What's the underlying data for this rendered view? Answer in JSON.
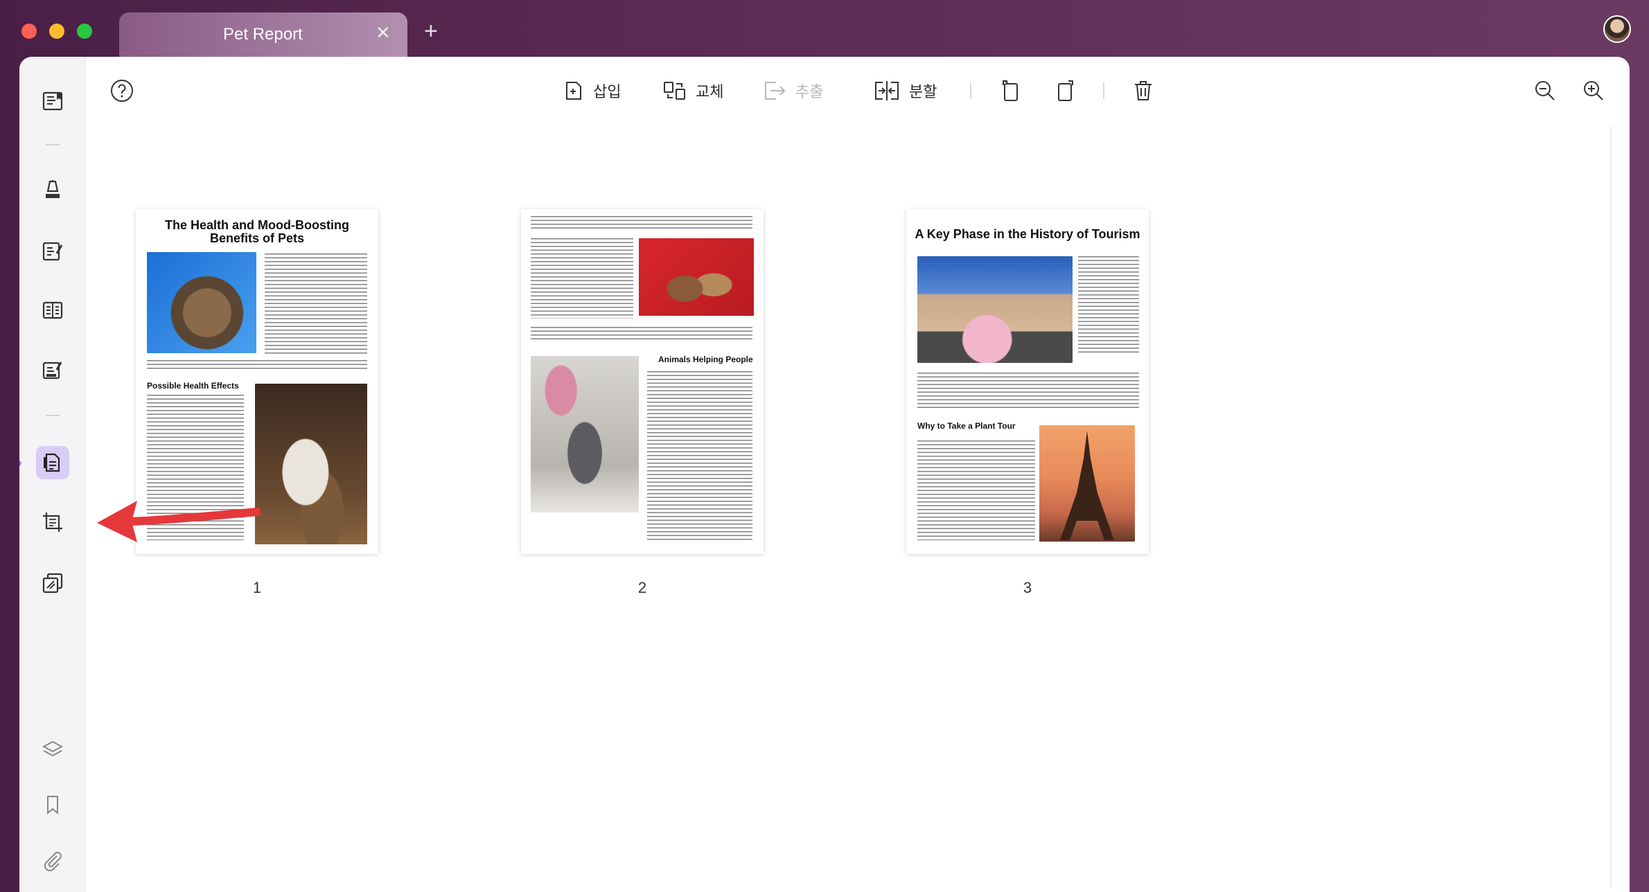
{
  "tab": {
    "title": "Pet Report",
    "close": "✕",
    "add": "+"
  },
  "toolbar": {
    "insert": "삽입",
    "replace": "교체",
    "extract": "추출",
    "split": "분할"
  },
  "pages": [
    {
      "number": "1",
      "title": "The Health and Mood-Boosting Benefits of Pets",
      "heading": "Possible Health Effects"
    },
    {
      "number": "2",
      "heading": "Animals Helping People"
    },
    {
      "number": "3",
      "title": "A Key Phase in the History of Tourism",
      "heading": "Why to Take a Plant Tour"
    }
  ],
  "colors": {
    "accent": "#a68ae6",
    "active_bg": "#d9ccf5",
    "arrow": "#e5383b"
  }
}
